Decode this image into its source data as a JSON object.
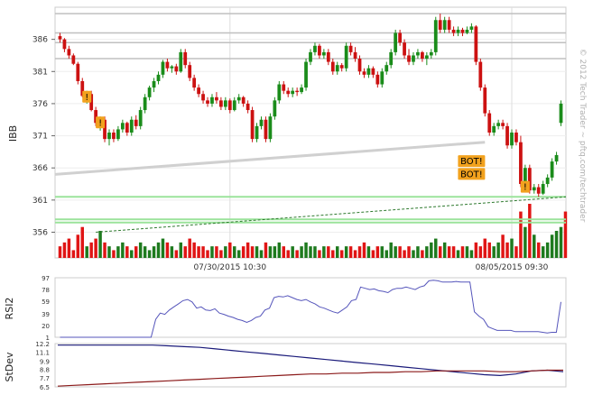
{
  "watermark": "© 2012 Tech Trader ~ pftq.com/techtrader",
  "date_labels": [
    "07/30/2015 10:30",
    "08/05/2015 09:30"
  ],
  "colors": {
    "up": "#1a8c1a",
    "down": "#cc1111",
    "vol_up": "#1e7a1e",
    "vol_down": "#e01515",
    "indicator": "#5555bb",
    "stdev_line": "#1a1a7a",
    "stdev_avg": "#8b1a1a",
    "support": "#9be39b",
    "resistance": "#c0c0c0",
    "marker": "#f2a21e"
  },
  "chart_data": [
    {
      "type": "candlestick",
      "ylabel": "IBB",
      "yticks": [
        386,
        381,
        376,
        371,
        366,
        361,
        356
      ],
      "ylim": [
        352,
        391
      ],
      "dates_at": [
        {
          "label": "07/30/2015 10:30",
          "bar": 38
        },
        {
          "label": "08/05/2015 09:30",
          "bar": 101
        }
      ],
      "candles": [
        [
          386.5,
          387.0,
          385.5,
          386.0
        ],
        [
          386.0,
          386.2,
          384.0,
          384.5
        ],
        [
          384.5,
          385.0,
          383.0,
          383.5
        ],
        [
          383.5,
          383.8,
          382.0,
          382.2
        ],
        [
          382.2,
          382.5,
          379.0,
          379.5
        ],
        [
          379.5,
          380.0,
          377.0,
          377.2
        ],
        [
          377.2,
          378.0,
          376.0,
          377.5
        ],
        [
          377.5,
          378.0,
          374.8,
          375.0
        ],
        [
          375.0,
          375.5,
          372.5,
          373.0
        ],
        [
          373.0,
          374.0,
          371.8,
          373.5
        ],
        [
          373.5,
          374.0,
          370.0,
          370.5
        ],
        [
          370.5,
          372.0,
          369.5,
          371.5
        ],
        [
          371.5,
          372.0,
          370.0,
          370.5
        ],
        [
          370.5,
          372.5,
          370.2,
          372.0
        ],
        [
          372.0,
          373.5,
          371.5,
          373.0
        ],
        [
          373.0,
          373.2,
          371.0,
          371.5
        ],
        [
          371.5,
          374.0,
          371.0,
          373.5
        ],
        [
          373.5,
          374.2,
          372.0,
          372.5
        ],
        [
          372.5,
          375.5,
          372.0,
          375.0
        ],
        [
          375.0,
          377.5,
          374.5,
          377.0
        ],
        [
          377.0,
          378.8,
          376.5,
          378.5
        ],
        [
          378.5,
          380.0,
          377.8,
          379.5
        ],
        [
          379.5,
          381.0,
          379.0,
          380.5
        ],
        [
          380.5,
          382.8,
          380.0,
          382.5
        ],
        [
          382.5,
          383.0,
          381.0,
          381.5
        ],
        [
          381.5,
          382.0,
          380.8,
          381.8
        ],
        [
          381.8,
          382.2,
          380.5,
          381.0
        ],
        [
          381.0,
          384.5,
          380.8,
          384.0
        ],
        [
          384.0,
          384.5,
          381.5,
          382.0
        ],
        [
          382.0,
          382.5,
          379.5,
          380.0
        ],
        [
          380.0,
          380.5,
          378.0,
          378.5
        ],
        [
          378.5,
          379.0,
          377.0,
          377.5
        ],
        [
          377.5,
          378.0,
          376.0,
          376.5
        ],
        [
          376.5,
          377.0,
          375.5,
          376.0
        ],
        [
          376.0,
          377.5,
          375.5,
          377.0
        ],
        [
          377.0,
          377.8,
          376.0,
          376.5
        ],
        [
          376.5,
          377.0,
          375.0,
          375.5
        ],
        [
          375.5,
          377.0,
          375.0,
          376.5
        ],
        [
          376.5,
          376.8,
          374.5,
          375.0
        ],
        [
          375.0,
          377.0,
          374.8,
          376.5
        ],
        [
          376.5,
          377.5,
          376.0,
          377.0
        ],
        [
          377.0,
          377.2,
          375.5,
          376.0
        ],
        [
          376.0,
          376.5,
          374.5,
          375.0
        ],
        [
          375.0,
          375.5,
          370.0,
          370.5
        ],
        [
          370.5,
          373.0,
          370.0,
          372.5
        ],
        [
          372.5,
          374.0,
          372.0,
          373.5
        ],
        [
          373.5,
          374.0,
          370.0,
          370.5
        ],
        [
          370.5,
          374.5,
          370.0,
          374.0
        ],
        [
          374.0,
          377.0,
          373.5,
          376.5
        ],
        [
          376.5,
          379.5,
          376.0,
          379.0
        ],
        [
          379.0,
          379.5,
          377.5,
          378.0
        ],
        [
          378.0,
          378.5,
          377.0,
          377.5
        ],
        [
          377.5,
          378.5,
          377.0,
          378.0
        ],
        [
          378.0,
          378.5,
          377.2,
          377.8
        ],
        [
          377.8,
          379.0,
          377.5,
          378.5
        ],
        [
          378.5,
          383.0,
          378.0,
          382.5
        ],
        [
          382.5,
          384.5,
          382.0,
          384.0
        ],
        [
          384.0,
          385.5,
          383.5,
          385.0
        ],
        [
          385.0,
          385.3,
          383.0,
          383.5
        ],
        [
          383.5,
          384.5,
          383.0,
          384.0
        ],
        [
          384.0,
          384.5,
          382.0,
          382.5
        ],
        [
          382.5,
          383.0,
          380.5,
          381.0
        ],
        [
          381.0,
          382.5,
          380.5,
          382.0
        ],
        [
          382.0,
          382.3,
          381.0,
          381.5
        ],
        [
          381.5,
          385.5,
          381.0,
          385.0
        ],
        [
          385.0,
          385.5,
          383.5,
          384.0
        ],
        [
          384.0,
          384.8,
          382.5,
          383.0
        ],
        [
          383.0,
          383.5,
          380.5,
          381.0
        ],
        [
          381.0,
          381.5,
          380.0,
          380.5
        ],
        [
          380.5,
          382.0,
          380.0,
          381.5
        ],
        [
          381.5,
          381.8,
          380.0,
          380.5
        ],
        [
          380.5,
          381.0,
          378.5,
          379.0
        ],
        [
          379.0,
          381.5,
          378.5,
          381.0
        ],
        [
          381.0,
          382.5,
          380.5,
          382.0
        ],
        [
          382.0,
          384.5,
          381.5,
          384.0
        ],
        [
          384.0,
          387.5,
          383.5,
          387.0
        ],
        [
          387.0,
          387.5,
          385.0,
          385.5
        ],
        [
          385.5,
          386.0,
          383.0,
          383.5
        ],
        [
          383.5,
          384.5,
          382.0,
          382.5
        ],
        [
          382.5,
          384.0,
          382.0,
          383.5
        ],
        [
          383.5,
          384.5,
          383.0,
          384.0
        ],
        [
          384.0,
          384.2,
          382.5,
          383.0
        ],
        [
          383.0,
          384.0,
          382.0,
          383.5
        ],
        [
          383.5,
          384.5,
          383.0,
          384.0
        ],
        [
          384.0,
          389.5,
          383.5,
          389.0
        ],
        [
          389.0,
          390.0,
          387.0,
          387.5
        ],
        [
          387.5,
          389.5,
          387.0,
          389.0
        ],
        [
          389.0,
          389.5,
          387.0,
          387.5
        ],
        [
          387.5,
          388.0,
          386.5,
          387.0
        ],
        [
          387.0,
          388.0,
          386.5,
          387.5
        ],
        [
          387.5,
          387.8,
          386.5,
          387.0
        ],
        [
          387.0,
          388.0,
          386.8,
          387.5
        ],
        [
          387.5,
          388.5,
          387.0,
          388.0
        ],
        [
          388.0,
          388.2,
          382.0,
          382.5
        ],
        [
          382.5,
          383.0,
          378.0,
          378.5
        ],
        [
          378.5,
          379.0,
          374.0,
          374.5
        ],
        [
          374.5,
          375.0,
          371.0,
          371.5
        ],
        [
          371.5,
          373.0,
          371.0,
          372.5
        ],
        [
          372.5,
          373.5,
          372.0,
          373.0
        ],
        [
          373.0,
          373.5,
          372.0,
          372.5
        ],
        [
          372.5,
          373.0,
          369.0,
          369.5
        ],
        [
          369.5,
          372.0,
          369.0,
          371.5
        ],
        [
          371.5,
          372.0,
          369.5,
          370.0
        ],
        [
          370.0,
          371.0,
          363.0,
          363.5
        ],
        [
          363.5,
          366.5,
          363.0,
          366.0
        ],
        [
          366.0,
          366.5,
          362.0,
          362.5
        ],
        [
          362.5,
          363.5,
          362.0,
          363.0
        ],
        [
          363.0,
          363.5,
          361.5,
          362.0
        ],
        [
          362.0,
          364.0,
          361.8,
          363.5
        ],
        [
          363.5,
          365.0,
          363.0,
          364.5
        ],
        [
          364.5,
          367.5,
          364.0,
          367.0
        ],
        [
          367.0,
          368.5,
          366.5,
          368.0
        ],
        [
          373.0,
          376.5,
          372.5,
          376.0
        ]
      ],
      "volumes": [
        3,
        4,
        5,
        2,
        6,
        8,
        3,
        4,
        5,
        7,
        4,
        3,
        2,
        3,
        4,
        3,
        2,
        3,
        4,
        3,
        2,
        3,
        4,
        5,
        4,
        3,
        2,
        4,
        3,
        5,
        4,
        3,
        3,
        2,
        3,
        3,
        2,
        3,
        4,
        3,
        2,
        3,
        4,
        3,
        3,
        2,
        4,
        3,
        3,
        4,
        3,
        2,
        3,
        2,
        3,
        4,
        3,
        3,
        2,
        3,
        3,
        2,
        3,
        2,
        3,
        3,
        2,
        3,
        4,
        3,
        2,
        3,
        3,
        2,
        4,
        3,
        3,
        2,
        3,
        2,
        3,
        2,
        3,
        4,
        5,
        3,
        4,
        3,
        3,
        2,
        3,
        3,
        2,
        4,
        3,
        5,
        4,
        3,
        4,
        6,
        4,
        5,
        3,
        12,
        8,
        14,
        6,
        4,
        3,
        4,
        6,
        7,
        8,
        12
      ],
      "horizontal_levels": [
        {
          "price": 387.0,
          "kind": "resistance"
        },
        {
          "price": 383.0,
          "kind": "resistance"
        },
        {
          "price": 385.5,
          "kind": "resistance"
        },
        {
          "price": 390.0,
          "kind": "resistance"
        },
        {
          "price": 361.5,
          "kind": "support"
        },
        {
          "price": 358.0,
          "kind": "support"
        },
        {
          "price": 357.5,
          "kind": "support"
        }
      ],
      "markers": [
        {
          "bar": 6,
          "price": 377,
          "text": "!"
        },
        {
          "bar": 9,
          "price": 373,
          "text": "!"
        },
        {
          "bar": 104,
          "price": 363,
          "text": "!"
        },
        {
          "bar": 92,
          "price": 367,
          "text": "BOT!"
        },
        {
          "bar": 92,
          "price": 365,
          "text": "BOT!"
        }
      ]
    },
    {
      "type": "line",
      "ylabel": "RSI2",
      "yticks": [
        97,
        78,
        59,
        39,
        20,
        1
      ],
      "ylim": [
        1,
        97
      ],
      "values": [
        1,
        1,
        1,
        1,
        1,
        1,
        1,
        1,
        1,
        1,
        1,
        1,
        1,
        1,
        1,
        1,
        1,
        1,
        1,
        1,
        1,
        30,
        40,
        38,
        45,
        50,
        55,
        60,
        62,
        58,
        48,
        50,
        45,
        44,
        47,
        40,
        38,
        35,
        33,
        30,
        28,
        25,
        28,
        33,
        35,
        45,
        48,
        65,
        67,
        66,
        68,
        65,
        62,
        60,
        62,
        58,
        55,
        50,
        48,
        45,
        42,
        40,
        45,
        50,
        60,
        62,
        82,
        80,
        78,
        79,
        76,
        75,
        73,
        78,
        80,
        80,
        82,
        80,
        78,
        82,
        84,
        92,
        93,
        92,
        90,
        90,
        90,
        91,
        90,
        90,
        90,
        42,
        35,
        30,
        18,
        15,
        12,
        12,
        12,
        12,
        10,
        10,
        10,
        10,
        10,
        10,
        9,
        8,
        9,
        9,
        58
      ]
    },
    {
      "type": "line",
      "ylabel": "StDev",
      "yticks": [
        12.2,
        11.1,
        9.9,
        8.8,
        7.7,
        6.5
      ],
      "ylim": [
        6.5,
        12.2
      ],
      "series": [
        {
          "role": "stdev",
          "values": [
            12.0,
            12.0,
            12.0,
            12.0,
            12.0,
            12.0,
            12.0,
            11.9,
            11.8,
            11.7,
            11.5,
            11.3,
            11.1,
            10.9,
            10.7,
            10.5,
            10.3,
            10.1,
            9.9,
            9.7,
            9.5,
            9.3,
            9.1,
            8.9,
            8.7,
            8.5,
            8.3,
            8.1,
            8.0,
            8.2,
            8.6,
            8.7,
            8.5
          ]
        },
        {
          "role": "average",
          "values": [
            6.6,
            6.7,
            6.8,
            6.9,
            7.0,
            7.1,
            7.2,
            7.3,
            7.4,
            7.5,
            7.6,
            7.7,
            7.8,
            7.9,
            8.0,
            8.1,
            8.2,
            8.2,
            8.3,
            8.3,
            8.4,
            8.4,
            8.5,
            8.5,
            8.6,
            8.6,
            8.6,
            8.6,
            8.5,
            8.5,
            8.6,
            8.7,
            8.7
          ]
        }
      ]
    }
  ]
}
